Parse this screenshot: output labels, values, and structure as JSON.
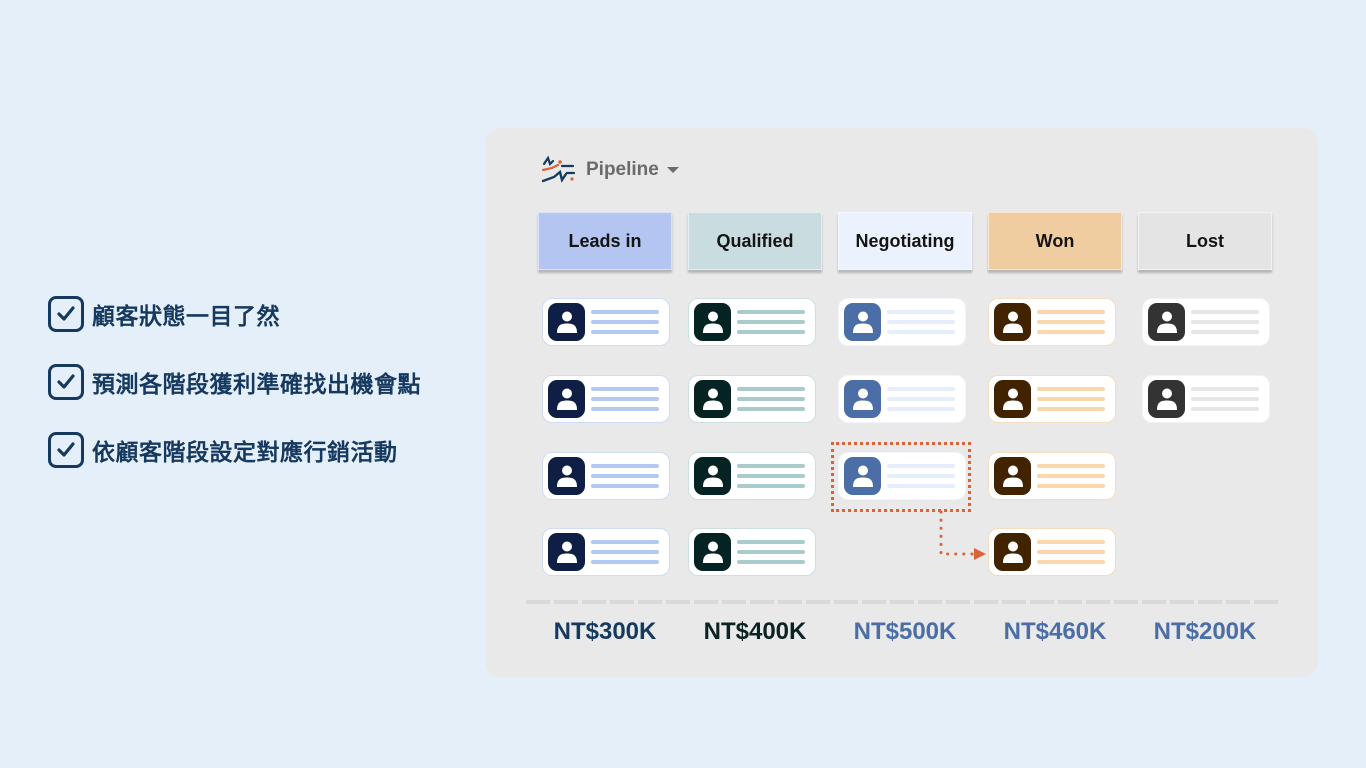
{
  "features": [
    {
      "icon": "checkbox-checked-icon",
      "text": "顧客狀態一目了然"
    },
    {
      "icon": "checkbox-checked-icon",
      "text": "預測各階段獲利準確找出機會點"
    },
    {
      "icon": "checkbox-checked-icon",
      "text": "依顧客階段設定對應行銷活動"
    }
  ],
  "header": {
    "logo": "brand-logo-icon",
    "title": "Pipeline",
    "dropdown_icon": "caret-down-icon"
  },
  "stages": [
    {
      "label": "Leads in",
      "header_bg": "#b3c5f0",
      "avatar_bg": "#0e1e45",
      "line_color": "#b3c9f2",
      "border": "#cfdcf5",
      "total": "NT$300K",
      "total_color": "#163a5f",
      "cards": 4
    },
    {
      "label": "Qualified",
      "header_bg": "#c9dde0",
      "avatar_bg": "#052322",
      "line_color": "#a9cbcb",
      "border": "#cde0e0",
      "total": "NT$400K",
      "total_color": "#0b2322",
      "cards": 4
    },
    {
      "label": "Negotiating",
      "header_bg": "#ebf1fd",
      "avatar_bg": "#4a6ea5",
      "line_color": "#e6eefc",
      "border": "#f2f5fc",
      "total": "NT$500K",
      "total_color": "#4a6ea5",
      "cards": 3
    },
    {
      "label": "Won",
      "header_bg": "#f0cca1",
      "avatar_bg": "#422300",
      "line_color": "#fbd6a8",
      "border": "#f6dcc0",
      "total": "NT$460K",
      "total_color": "#4a6ea5",
      "cards": 4
    },
    {
      "label": "Lost",
      "header_bg": "#e4e4e4",
      "avatar_bg": "#333333",
      "line_color": "#e6e6e6",
      "border": "#f2f2f2",
      "total": "NT$200K",
      "total_color": "#4a6ea5",
      "cards": 2
    }
  ],
  "drag_hint": {
    "from_stage": "Negotiating",
    "to_stage": "Won",
    "color": "#d9633a"
  }
}
